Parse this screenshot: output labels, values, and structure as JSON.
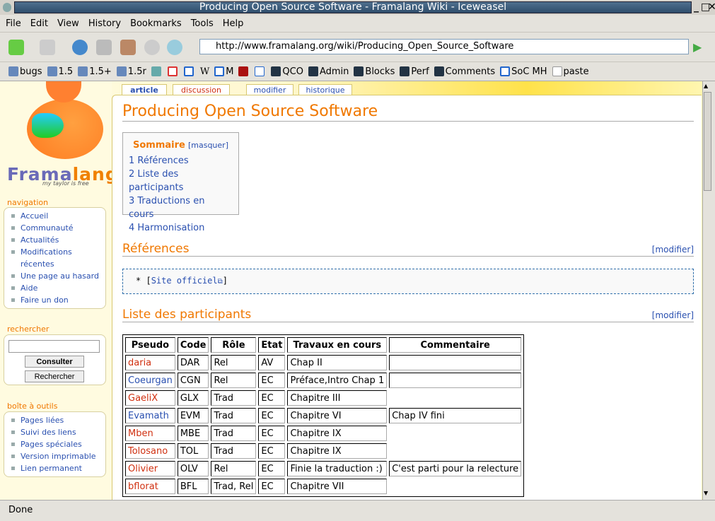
{
  "window": {
    "title": "Producing Open Source Software - Framalang Wiki - Iceweasel"
  },
  "menu": [
    "File",
    "Edit",
    "View",
    "History",
    "Bookmarks",
    "Tools",
    "Help"
  ],
  "url": "http://www.framalang.org/wiki/Producing_Open_Source_Software",
  "bookmarks": [
    "bugs",
    "1.5",
    "1.5+",
    "1.5r",
    "",
    "",
    "",
    "W",
    "M",
    "",
    "",
    "QCO",
    "Admin",
    "Blocks",
    "Perf",
    "Comments",
    "SoC MH",
    "paste"
  ],
  "logo": {
    "name1": "Frama",
    "name2": "lang",
    "tagline": "my taylor is free"
  },
  "sidebar": {
    "navigation": {
      "title": "navigation",
      "items": [
        "Accueil",
        "Communauté",
        "Actualités",
        "Modifications récentes",
        "Une page au hasard",
        "Aide",
        "Faire un don"
      ]
    },
    "search": {
      "title": "rechercher",
      "go": "Consulter",
      "search": "Rechercher"
    },
    "toolbox": {
      "title": "boîte à outils",
      "items": [
        "Pages liées",
        "Suivi des liens",
        "Pages spéciales",
        "Version imprimable",
        "Lien permanent"
      ]
    }
  },
  "tabs": [
    "article",
    "discussion",
    "modifier",
    "historique"
  ],
  "page": {
    "title": "Producing Open Source Software",
    "toc": {
      "title": "Sommaire",
      "toggle": "masquer",
      "items": [
        "1 Références",
        "2 Liste des participants",
        "3 Traductions en cours",
        "4 Harmonisation"
      ]
    },
    "section1": {
      "title": "Références",
      "edit": "modifier",
      "pre_prefix": "* [",
      "link": "Site officiel",
      "pre_suffix": "]"
    },
    "section2": {
      "title": "Liste des participants",
      "edit": "modifier"
    },
    "table": {
      "headers": [
        "Pseudo",
        "Code",
        "Rôle",
        "Etat",
        "Travaux en cours",
        "Commentaire"
      ],
      "rows": [
        {
          "pseudo": "daria",
          "link": "red",
          "code": "DAR",
          "role": "Rel",
          "etat": "AV",
          "travaux": "Chap II",
          "comment": ""
        },
        {
          "pseudo": "Coeurgan",
          "link": "blue",
          "code": "CGN",
          "role": "Rel",
          "etat": "EC",
          "travaux": "Préface,Intro Chap 1",
          "comment": ""
        },
        {
          "pseudo": "GaeliX",
          "link": "red",
          "code": "GLX",
          "role": "Trad",
          "etat": "EC",
          "travaux": "Chapitre III",
          "comment": null
        },
        {
          "pseudo": "Evamath",
          "link": "blue",
          "code": "EVM",
          "role": "Trad",
          "etat": "EC",
          "travaux": "Chapitre VI",
          "comment": "Chap IV fini"
        },
        {
          "pseudo": "Mben",
          "link": "red",
          "code": "MBE",
          "role": "Trad",
          "etat": "EC",
          "travaux": "Chapitre IX",
          "comment": null
        },
        {
          "pseudo": "Tolosano",
          "link": "red",
          "code": "TOL",
          "role": "Trad",
          "etat": "EC",
          "travaux": "Chapitre IX",
          "comment": null
        },
        {
          "pseudo": "Olivier",
          "link": "red",
          "code": "OLV",
          "role": "Rel",
          "etat": "EC",
          "travaux": "Finie la traduction :)",
          "comment": "C'est parti pour la relecture"
        },
        {
          "pseudo": "bflorat",
          "link": "red",
          "code": "BFL",
          "role": "Trad, Rel",
          "etat": "EC",
          "travaux": "Chapitre VII",
          "comment": null
        }
      ]
    }
  },
  "status": "Done",
  "colors": {
    "accent": "#f07800",
    "link": "#2a50b0",
    "redlink": "#d03010"
  }
}
